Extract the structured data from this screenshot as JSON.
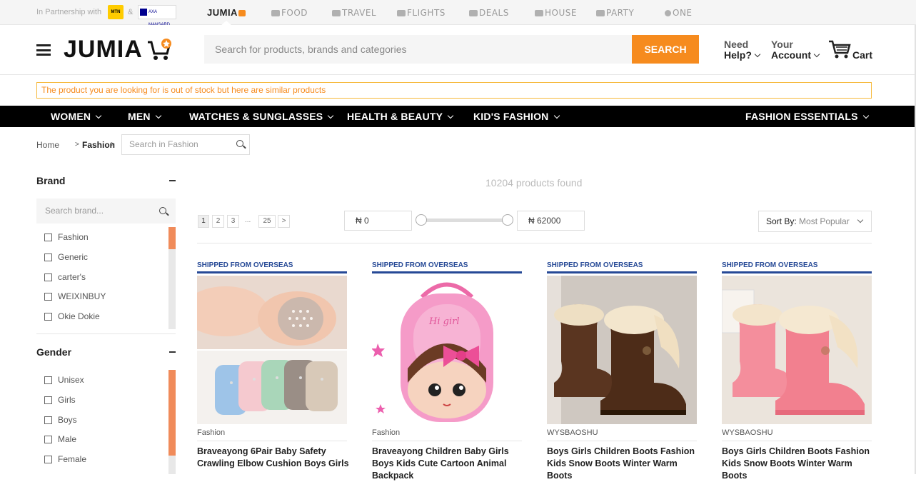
{
  "topbar": {
    "partnership_text": "In Partnership with",
    "mtn_logo_text": "MTN",
    "amp": "&",
    "axa_logo_text": "AXA MANSARD",
    "services": [
      {
        "label": "JUMIA",
        "icon": "cart-icon",
        "active": true
      },
      {
        "label": "FOOD",
        "icon": "food-icon",
        "active": false
      },
      {
        "label": "TRAVEL",
        "icon": "travel-icon",
        "active": false
      },
      {
        "label": "FLIGHTS",
        "icon": "plane-icon",
        "active": false
      },
      {
        "label": "DEALS",
        "icon": "deals-icon",
        "active": false
      },
      {
        "label": "HOUSE",
        "icon": "house-icon",
        "active": false
      },
      {
        "label": "PARTY",
        "icon": "party-icon",
        "active": false
      },
      {
        "label": "ONE",
        "icon": "one-icon",
        "active": false
      }
    ]
  },
  "header": {
    "logo_text": "JUMIA",
    "search_placeholder": "Search for products, brands and categories",
    "search_button": "SEARCH",
    "help_top": "Need",
    "help_bottom": "Help?",
    "account_top": "Your",
    "account_bottom": "Account",
    "cart_label": "Cart"
  },
  "notice": "The product you are looking for is out of stock but here are similar products",
  "categories": [
    "WOMEN",
    "MEN",
    "WATCHES & SUNGLASSES",
    "HEALTH & BEAUTY",
    "KID'S FASHION",
    "FASHION ESSENTIALS"
  ],
  "breadcrumb": {
    "home": "Home",
    "sep": ">",
    "current": "Fashion",
    "search_placeholder": "Search in Fashion"
  },
  "sidebar": {
    "brand": {
      "title": "Brand",
      "search_placeholder": "Search brand...",
      "items": [
        "Fashion",
        "Generic",
        "carter's",
        "WEIXINBUY",
        "Okie Dokie"
      ]
    },
    "gender": {
      "title": "Gender",
      "items": [
        "Unisex",
        "Girls",
        "Boys",
        "Male",
        "Female"
      ]
    }
  },
  "main": {
    "products_found": "10204 products found",
    "pagination": [
      "1",
      "2",
      "3",
      "...",
      "25",
      ">"
    ],
    "price_min": "₦ 0",
    "price_max": "₦ 62000",
    "sort_label": "Sort By:",
    "sort_value": "Most Popular"
  },
  "products": [
    {
      "ship": "SHIPPED FROM OVERSEAS",
      "brand": "Fashion",
      "title": "Braveayong 6Pair Baby Safety Crawling Elbow Cushion Boys Girls"
    },
    {
      "ship": "SHIPPED FROM OVERSEAS",
      "brand": "Fashion",
      "title": "Braveayong Children Baby Girls Boys Kids Cute Cartoon Animal Backpack"
    },
    {
      "ship": "SHIPPED FROM OVERSEAS",
      "brand": "WYSBAOSHU",
      "title": "Boys Girls Children Boots Fashion Kids Snow Boots Winter Warm Boots"
    },
    {
      "ship": "SHIPPED FROM OVERSEAS",
      "brand": "WYSBAOSHU",
      "title": "Boys Girls Children Boots Fashion Kids Snow Boots Winter Warm Boots"
    }
  ],
  "colors": {
    "accent": "#f68b1e",
    "shipped": "#264996",
    "scroll_thumb": "#f08b5a"
  }
}
